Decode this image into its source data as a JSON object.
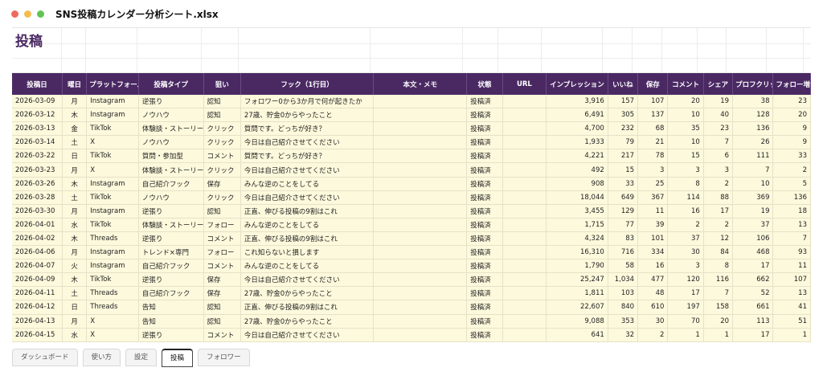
{
  "window": {
    "title": "SNS投稿カレンダー分析シート.xlsx",
    "dots": [
      "#ee6a5f",
      "#f5bd4f",
      "#61c454"
    ]
  },
  "sheet": {
    "title": "投稿",
    "headers": [
      "投稿日",
      "曜日",
      "プラットフォーム",
      "投稿タイプ",
      "狙い",
      "フック（1行目）",
      "本文・メモ",
      "状態",
      "URL",
      "インプレッション",
      "いいね",
      "保存",
      "コメント",
      "シェア",
      "プロフクリック",
      "フォロー増"
    ],
    "rows": [
      [
        "2026-03-09",
        "月",
        "Instagram",
        "逆張り",
        "認知",
        "フォロワー0から3か月で何が起きたか",
        "",
        "投稿済",
        "",
        "3,916",
        "157",
        "107",
        "20",
        "19",
        "38",
        "23"
      ],
      [
        "2026-03-12",
        "木",
        "Instagram",
        "ノウハウ",
        "認知",
        "27歳、貯金0からやったこと",
        "",
        "投稿済",
        "",
        "6,491",
        "305",
        "137",
        "10",
        "40",
        "128",
        "20"
      ],
      [
        "2026-03-13",
        "金",
        "TikTok",
        "体験談・ストーリー",
        "クリック",
        "質問です。どっちが好き？",
        "",
        "投稿済",
        "",
        "4,700",
        "232",
        "68",
        "35",
        "23",
        "136",
        "9"
      ],
      [
        "2026-03-14",
        "土",
        "X",
        "ノウハウ",
        "クリック",
        "今日は自己紹介させてください",
        "",
        "投稿済",
        "",
        "1,933",
        "79",
        "21",
        "10",
        "7",
        "26",
        "9"
      ],
      [
        "2026-03-22",
        "日",
        "TikTok",
        "質問・参加型",
        "コメント",
        "質問です。どっちが好き？",
        "",
        "投稿済",
        "",
        "4,221",
        "217",
        "78",
        "15",
        "6",
        "111",
        "33"
      ],
      [
        "2026-03-23",
        "月",
        "X",
        "体験談・ストーリー",
        "クリック",
        "今日は自己紹介させてください",
        "",
        "投稿済",
        "",
        "492",
        "15",
        "3",
        "3",
        "3",
        "7",
        "2"
      ],
      [
        "2026-03-26",
        "木",
        "Instagram",
        "自己紹介フック",
        "保存",
        "みんな逆のことをしてる",
        "",
        "投稿済",
        "",
        "908",
        "33",
        "25",
        "8",
        "2",
        "10",
        "5"
      ],
      [
        "2026-03-28",
        "土",
        "TikTok",
        "ノウハウ",
        "クリック",
        "今日は自己紹介させてください",
        "",
        "投稿済",
        "",
        "18,044",
        "649",
        "367",
        "114",
        "88",
        "369",
        "136"
      ],
      [
        "2026-03-30",
        "月",
        "Instagram",
        "逆張り",
        "認知",
        "正直、伸びる投稿の9割はこれ",
        "",
        "投稿済",
        "",
        "3,455",
        "129",
        "11",
        "16",
        "17",
        "19",
        "18"
      ],
      [
        "2026-04-01",
        "水",
        "TikTok",
        "体験談・ストーリー",
        "フォロー",
        "みんな逆のことをしてる",
        "",
        "投稿済",
        "",
        "1,715",
        "77",
        "39",
        "2",
        "2",
        "37",
        "13"
      ],
      [
        "2026-04-02",
        "木",
        "Threads",
        "逆張り",
        "コメント",
        "正直、伸びる投稿の9割はこれ",
        "",
        "投稿済",
        "",
        "4,324",
        "83",
        "101",
        "37",
        "12",
        "106",
        "7"
      ],
      [
        "2026-04-06",
        "月",
        "Instagram",
        "トレンド×専門",
        "フォロー",
        "これ知らないと損します",
        "",
        "投稿済",
        "",
        "16,310",
        "716",
        "334",
        "30",
        "84",
        "468",
        "93"
      ],
      [
        "2026-04-07",
        "火",
        "Instagram",
        "自己紹介フック",
        "コメント",
        "みんな逆のことをしてる",
        "",
        "投稿済",
        "",
        "1,790",
        "58",
        "16",
        "3",
        "8",
        "17",
        "11"
      ],
      [
        "2026-04-09",
        "木",
        "TikTok",
        "逆張り",
        "保存",
        "今日は自己紹介させてください",
        "",
        "投稿済",
        "",
        "25,247",
        "1,034",
        "477",
        "120",
        "116",
        "662",
        "107"
      ],
      [
        "2026-04-11",
        "土",
        "Threads",
        "自己紹介フック",
        "保存",
        "27歳、貯金0からやったこと",
        "",
        "投稿済",
        "",
        "1,811",
        "103",
        "48",
        "17",
        "7",
        "52",
        "13"
      ],
      [
        "2026-04-12",
        "日",
        "Threads",
        "告知",
        "認知",
        "正直、伸びる投稿の9割はこれ",
        "",
        "投稿済",
        "",
        "22,607",
        "840",
        "610",
        "197",
        "158",
        "661",
        "41"
      ],
      [
        "2026-04-13",
        "月",
        "X",
        "告知",
        "認知",
        "27歳、貯金0からやったこと",
        "",
        "投稿済",
        "",
        "9,088",
        "353",
        "30",
        "70",
        "20",
        "113",
        "51"
      ],
      [
        "2026-04-15",
        "水",
        "X",
        "逆張り",
        "コメント",
        "今日は自己紹介させてください",
        "",
        "投稿済",
        "",
        "641",
        "32",
        "2",
        "1",
        "1",
        "17",
        "1"
      ]
    ]
  },
  "tabs": [
    {
      "label": "ダッシュボード",
      "active": false
    },
    {
      "label": "使い方",
      "active": false
    },
    {
      "label": "設定",
      "active": false
    },
    {
      "label": "投稿",
      "active": true
    },
    {
      "label": "フォロワー",
      "active": false
    }
  ]
}
